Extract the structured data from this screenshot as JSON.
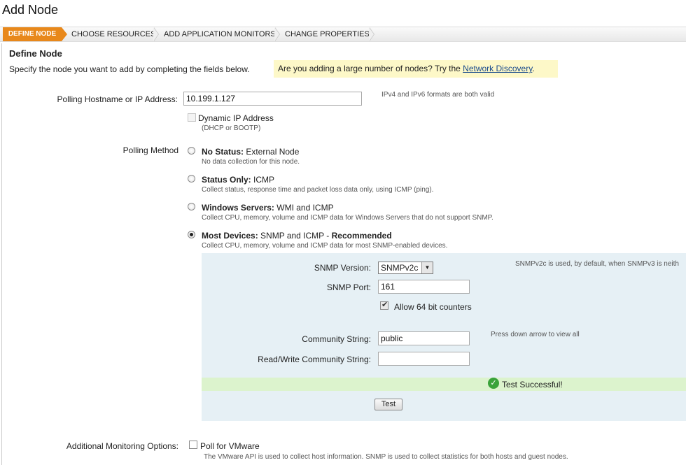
{
  "page": {
    "title": "Add Node"
  },
  "wizard": {
    "steps": [
      "DEFINE NODE",
      "CHOOSE RESOURCES",
      "ADD APPLICATION MONITORS",
      "CHANGE PROPERTIES"
    ],
    "active_color": "#e8881b"
  },
  "section": {
    "title": "Define Node",
    "intro": "Specify the node you want to add by completing the fields below.",
    "banner_text": "Are you adding a large number of nodes? Try the ",
    "banner_link": "Network Discovery",
    "banner_suffix": "."
  },
  "hostname": {
    "label": "Polling Hostname or IP Address:",
    "value": "10.199.1.127",
    "hint": "IPv4 and IPv6 formats are both valid"
  },
  "dynamic_ip": {
    "label": "Dynamic IP Address",
    "sub": "(DHCP or BOOTP)",
    "checked": false
  },
  "polling": {
    "label": "Polling Method",
    "options": [
      {
        "bold": "No Status:",
        "rest": " External Node",
        "desc": "No data collection for this node.",
        "selected": false
      },
      {
        "bold": "Status Only:",
        "rest": " ICMP",
        "desc": "Collect status, response time and packet loss data only, using ICMP (ping).",
        "selected": false
      },
      {
        "bold": "Windows Servers:",
        "rest": " WMI and ICMP",
        "desc": "Collect CPU, memory, volume and ICMP data for Windows Servers that do not support SNMP.",
        "selected": false
      },
      {
        "bold": "Most Devices:",
        "rest": " SNMP and ICMP - ",
        "rest_bold": "Recommended",
        "desc": "Collect CPU, memory, volume and ICMP data for most SNMP-enabled devices.",
        "selected": true
      }
    ]
  },
  "snmp": {
    "version_label": "SNMP Version:",
    "version_value": "SNMPv2c",
    "version_hint": "SNMPv2c is used, by default, when SNMPv3 is neith",
    "port_label": "SNMP Port:",
    "port_value": "161",
    "counters_label": "Allow 64 bit counters",
    "counters_checked": true,
    "community_label": "Community String:",
    "community_value": "public",
    "community_hint": "Press down arrow to view all",
    "rw_label": "Read/Write Community String:",
    "rw_value": "",
    "test_result": "Test Successful!",
    "test_button": "Test",
    "panel_color": "#e6f0f5",
    "success_color": "#dcf3cd"
  },
  "additional": {
    "label": "Additional Monitoring Options:",
    "vmware_label": "Poll for VMware",
    "vmware_desc": "The VMware API is used to collect host information. SNMP is used to collect statistics for both hosts and guest nodes.",
    "vmware_checked": false
  }
}
